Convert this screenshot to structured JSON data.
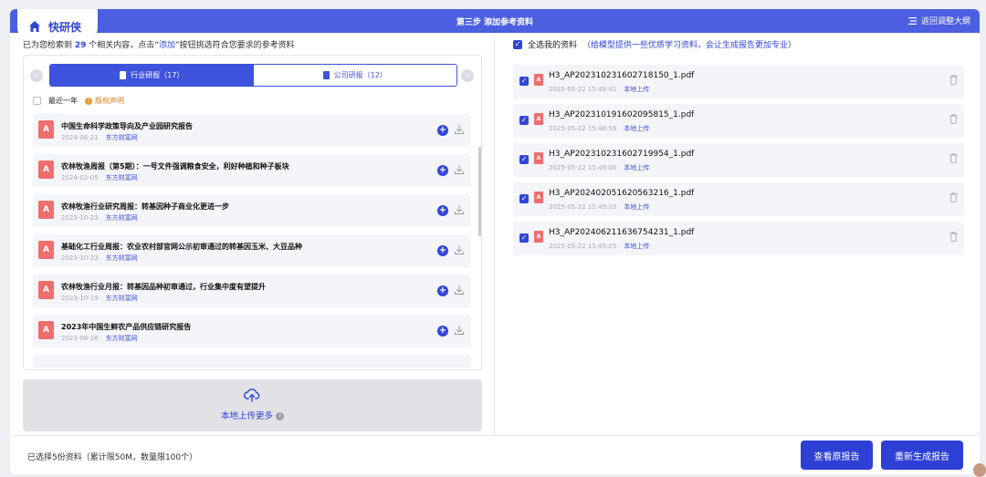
{
  "app": {
    "name": "快研侠"
  },
  "header": {
    "step_title": "第三步 添加参考资料",
    "back_label": "返回调整大纲"
  },
  "search": {
    "summary_pre": "已为您检索到",
    "count": "29",
    "summary_mid": "个相关内容，点击“",
    "add_word": "添加",
    "summary_post": "”按钮挑选符合您要求的参考资料"
  },
  "tabs": [
    {
      "label": "行业研报（17）",
      "active": true
    },
    {
      "label": "公司研报（12）",
      "active": false
    }
  ],
  "filters": {
    "recent_label": "最近一年",
    "copyright_label": "版权声明"
  },
  "results": [
    {
      "title": "中国生命科学政策导向及产业园研究报告",
      "date": "2024-06-21",
      "source": "东方财富网"
    },
    {
      "title": "农林牧渔周报（第5期）：一号文件强调粮食安全，利好种植和种子板块",
      "date": "2024-02-05",
      "source": "东方财富网"
    },
    {
      "title": "农林牧渔行业研究周报：转基因种子商业化更进一步",
      "date": "2023-10-23",
      "source": "东方财富网"
    },
    {
      "title": "基础化工行业周报：农业农村部官网公示初审通过的转基因玉米、大豆品种",
      "date": "2023-10-23",
      "source": "东方财富网"
    },
    {
      "title": "农林牧渔行业月报：转基因品种初审通过，行业集中度有望提升",
      "date": "2023-10-19",
      "source": "东方财富网"
    },
    {
      "title": "2023年中国生鲜农产品供应链研究报告",
      "date": "2023-06-16",
      "source": "东方财富网"
    }
  ],
  "upload": {
    "label": "本地上传更多"
  },
  "selected": {
    "select_all_label": "全选我的资料",
    "hint": "（给模型提供一些优质学习资料，会让生成报告更加专业）",
    "files": [
      {
        "name": "H3_AP202310231602718150_1.pdf",
        "time": "2025-05-22 15:48:41",
        "source": "本地上传"
      },
      {
        "name": "H3_AP202310191602095815_1.pdf",
        "time": "2025-05-22 15:48:59",
        "source": "本地上传"
      },
      {
        "name": "H3_AP202310231602719954_1.pdf",
        "time": "2025-05-22 15:49:00",
        "source": "本地上传"
      },
      {
        "name": "H3_AP202402051620563216_1.pdf",
        "time": "2025-05-22 15:49:03",
        "source": "本地上传"
      },
      {
        "name": "H3_AP202406211636754231_1.pdf",
        "time": "2025-05-22 15:49:05",
        "source": "本地上传"
      }
    ]
  },
  "footer": {
    "count_label": "已选择5份资料（累计限50M，数量限100个）",
    "view_button": "查看原报告",
    "regenerate_button": "重新生成报告"
  },
  "colors": {
    "primary": "#3046d8",
    "header": "#4b5fe0",
    "pdf": "#ee6e6e",
    "warning": "#e07c17"
  }
}
